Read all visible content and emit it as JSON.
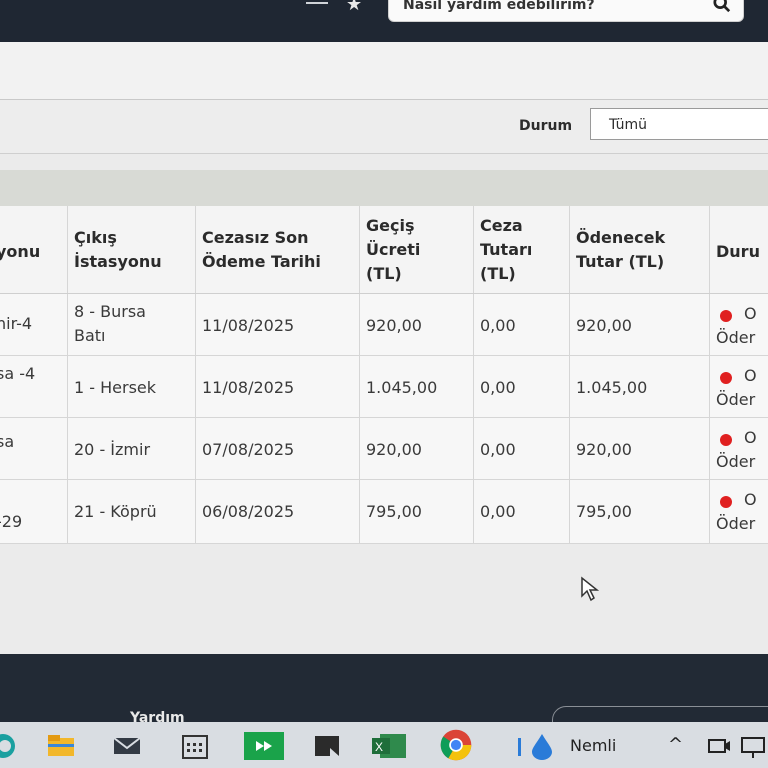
{
  "search": {
    "placeholder": "Nasıl yardım edebilirim?",
    "icon": "search-icon"
  },
  "filter": {
    "label": "Durum",
    "selected": "Tümü"
  },
  "table": {
    "headers": [
      "yonu",
      "Çıkış İstasyonu",
      "Cezasız Son Ödeme Tarihi",
      "Geçiş Ücreti (TL)",
      "Ceza Tutarı (TL)",
      "Ödenecek Tutar (TL)",
      "Duru"
    ],
    "rows": [
      {
        "entry": "nir-4",
        "exit": "8 - Bursa Batı",
        "due": "11/08/2025",
        "fee": "920,00",
        "penalty": "0,00",
        "total": "920,00",
        "status": "Öder",
        "status_head": "O"
      },
      {
        "entry": "sa -4",
        "exit": "1 - Hersek",
        "due": "11/08/2025",
        "fee": "1.045,00",
        "penalty": "0,00",
        "total": "1.045,00",
        "status": "Öder",
        "status_head": "O"
      },
      {
        "entry": "sa",
        "exit": "20 - İzmir",
        "due": "07/08/2025",
        "fee": "920,00",
        "penalty": "0,00",
        "total": "920,00",
        "status": "Öder",
        "status_head": "O"
      },
      {
        "entry": "-29",
        "exit": "21 - Köprü",
        "due": "06/08/2025",
        "fee": "795,00",
        "penalty": "0,00",
        "total": "795,00",
        "status": "Öder",
        "status_head": "O"
      }
    ],
    "status_color": "#e02020"
  },
  "footer": {
    "help_label": "Yardım"
  },
  "taskbar": {
    "weather_label": "Nemli",
    "icons": [
      "edge-icon",
      "file-explorer-icon",
      "mail-icon",
      "calendar-icon",
      "remote-app-icon",
      "snipping-tool-icon",
      "excel-icon",
      "chrome-icon",
      "weather-icon"
    ]
  }
}
